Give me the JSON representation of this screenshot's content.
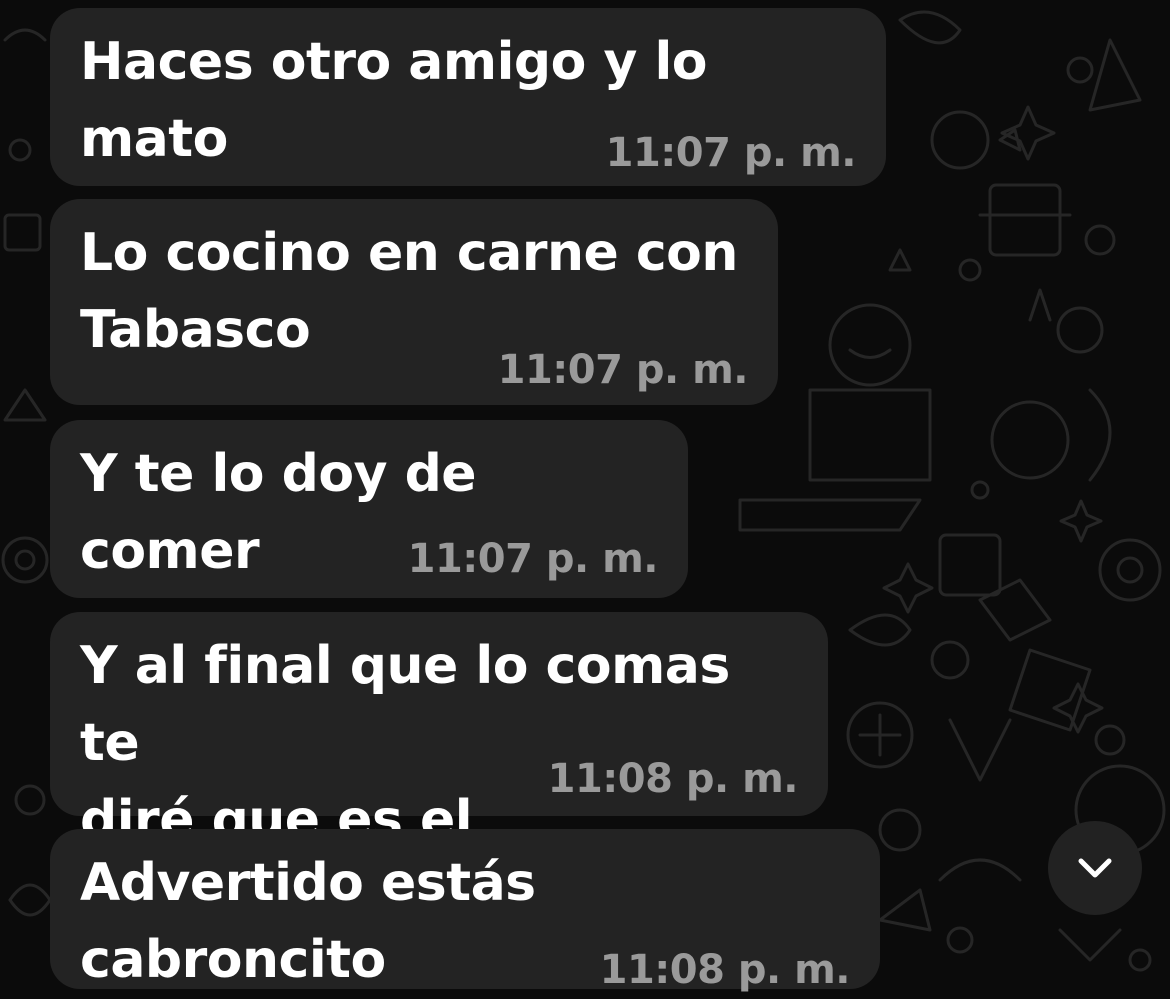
{
  "messages": [
    {
      "text": "Haces otro amigo y lo mato",
      "time": "11:07 p. m."
    },
    {
      "text": "Lo cocino en carne con\nTabasco",
      "time": "11:07 p. m."
    },
    {
      "text": "Y te lo doy de comer",
      "time": "11:07 p. m."
    },
    {
      "text": "Y al final que lo comas te\ndiré que es el",
      "time": "11:08 p. m."
    },
    {
      "text": "Advertido estás cabroncito",
      "time": "11:08 p. m."
    }
  ],
  "scroll_button": {
    "icon": "chevron-down-icon"
  },
  "colors": {
    "background": "#0b0b0b",
    "bubble": "#232323",
    "message_text": "#ffffff",
    "timestamp": "#9a9a9a",
    "scroll_button": "#222222"
  }
}
